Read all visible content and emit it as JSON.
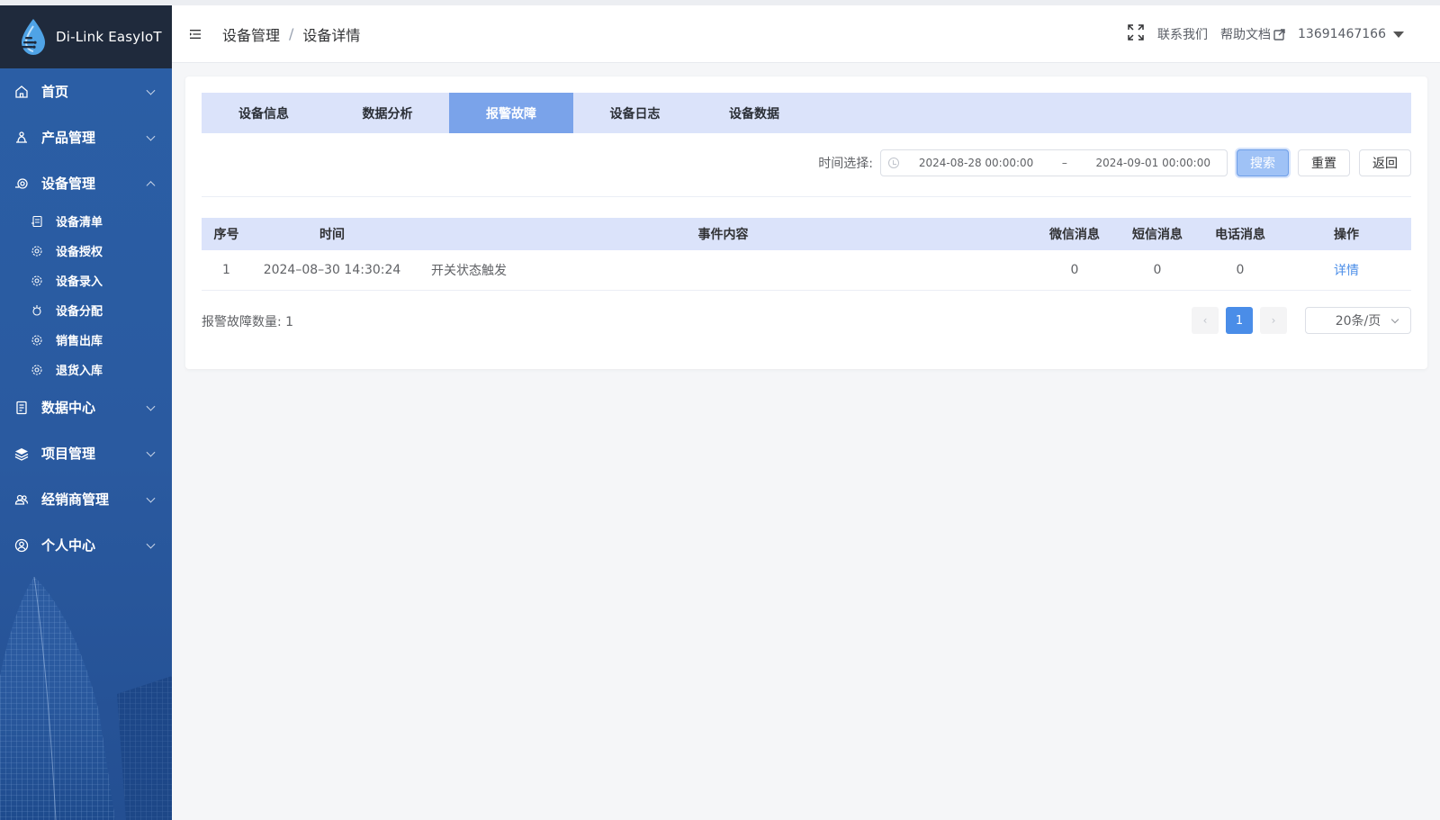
{
  "app": {
    "title": "Di-Link EasyIoT"
  },
  "sidebar": {
    "items": [
      {
        "label": "首页",
        "icon": "home-icon",
        "expanded": false
      },
      {
        "label": "产品管理",
        "icon": "product-icon",
        "expanded": false
      },
      {
        "label": "设备管理",
        "icon": "device-icon",
        "expanded": true,
        "children": [
          {
            "label": "设备清单",
            "icon": "list-icon"
          },
          {
            "label": "设备授权",
            "icon": "gear-icon"
          },
          {
            "label": "设备录入",
            "icon": "gear-icon"
          },
          {
            "label": "设备分配",
            "icon": "distribute-icon"
          },
          {
            "label": "销售出库",
            "icon": "gear-icon"
          },
          {
            "label": "退货入库",
            "icon": "gear-icon"
          }
        ]
      },
      {
        "label": "数据中心",
        "icon": "data-icon",
        "expanded": false
      },
      {
        "label": "项目管理",
        "icon": "layers-icon",
        "expanded": false
      },
      {
        "label": "经销商管理",
        "icon": "users-icon",
        "expanded": false
      },
      {
        "label": "个人中心",
        "icon": "user-icon",
        "expanded": false
      }
    ]
  },
  "header": {
    "breadcrumb": [
      "设备管理",
      "设备详情"
    ],
    "breadcrumb_sep": "/",
    "contact": "联系我们",
    "help": "帮助文档",
    "user": "13691467166"
  },
  "tabs": [
    {
      "label": "设备信息",
      "active": false
    },
    {
      "label": "数据分析",
      "active": false
    },
    {
      "label": "报警故障",
      "active": true
    },
    {
      "label": "设备日志",
      "active": false
    },
    {
      "label": "设备数据",
      "active": false
    }
  ],
  "filter": {
    "label": "时间选择:",
    "start": "2024-08-28 00:00:00",
    "range_sep": "–",
    "end": "2024-09-01 00:00:00",
    "search": "搜索",
    "reset": "重置",
    "back": "返回"
  },
  "table": {
    "headers": [
      "序号",
      "时间",
      "事件内容",
      "微信消息",
      "短信消息",
      "电话消息",
      "操作"
    ],
    "rows": [
      {
        "no": "1",
        "time": "2024–08–30 14:30:24",
        "content": "开关状态触发",
        "wechat": "0",
        "sms": "0",
        "phone": "0",
        "action": "详情"
      }
    ]
  },
  "footer": {
    "count": "报警故障数量: 1",
    "prev": "‹",
    "page": "1",
    "next": "›",
    "page_size": "20条/页"
  },
  "colors": {
    "sidebar": "#2b5fa6",
    "logo_bg": "#1f2a3c",
    "tab_bg": "#dbe3fa",
    "tab_active": "#7aa3ea",
    "primary": "#4a8de8"
  }
}
